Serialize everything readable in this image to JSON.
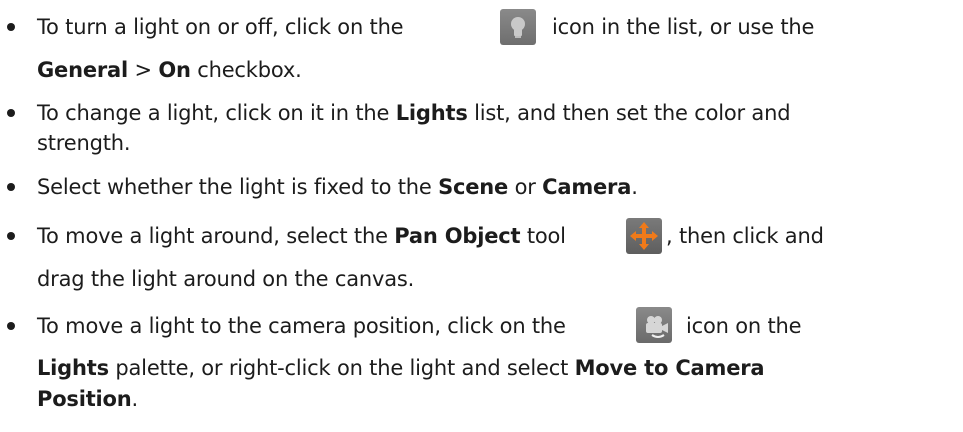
{
  "items": [
    {
      "l1": {
        "t1": "To turn a light on or off, click on the",
        "t2": "icon in the list, or use the"
      },
      "l2": {
        "b1": "General",
        "t1": " > ",
        "b2": "On",
        "t2": " checkbox."
      },
      "icon": "light-bulb-icon"
    },
    {
      "l1": {
        "t1": "To change a light, click on it in the ",
        "b1": "Lights",
        "t2": " list, and then set the color and"
      },
      "l2": {
        "t1": "strength."
      }
    },
    {
      "l1": {
        "t1": "Select whether the light is fixed to the ",
        "b1": "Scene",
        "t2": " or ",
        "b2": "Camera",
        "t3": "."
      }
    },
    {
      "l1": {
        "t1": "To move a light around, select the ",
        "b1": "Pan Object",
        "t2": " tool",
        "t3": ", then click and"
      },
      "l2": {
        "t1": "drag the light around on the canvas."
      },
      "icon": "pan-object-icon",
      "icon_color": "#f07a1a"
    },
    {
      "l1": {
        "t1": "To move a light to the camera position, click on the",
        "t2": "icon on the"
      },
      "l2": {
        "b1": "Lights",
        "t1": " palette, or right-click on the light and select ",
        "b2": "Move to Camera"
      },
      "l3": {
        "b1": "Position",
        "t1": "."
      },
      "icon": "move-to-camera-icon"
    }
  ]
}
